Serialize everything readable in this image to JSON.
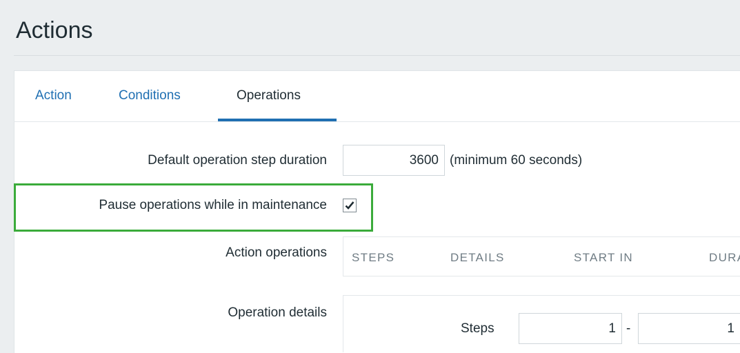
{
  "header": {
    "title": "Actions"
  },
  "tabs": [
    {
      "label": "Action"
    },
    {
      "label": "Conditions"
    },
    {
      "label": "Operations"
    }
  ],
  "form": {
    "step_duration": {
      "label": "Default operation step duration",
      "value": "3600",
      "hint": "(minimum 60 seconds)"
    },
    "pause_maintenance": {
      "label": "Pause operations while in maintenance",
      "checked": true
    },
    "action_operations": {
      "label": "Action operations",
      "columns": [
        "STEPS",
        "DETAILS",
        "START IN",
        "DURATION"
      ]
    },
    "operation_details": {
      "label": "Operation details",
      "steps_label": "Steps",
      "steps_from": "1",
      "steps_separator": "-",
      "steps_to": "1"
    }
  },
  "colors": {
    "accent": "#1f6fb2",
    "highlight": "#3aab3a",
    "background": "#ebeef0"
  }
}
